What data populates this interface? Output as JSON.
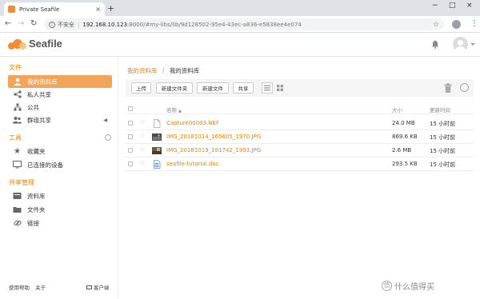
{
  "browser": {
    "tab_title": "Private Seafile",
    "tab_close": "×",
    "new_tab": "+",
    "win_min": "−",
    "win_max": "□",
    "win_close": "×",
    "back": "←",
    "forward": "→",
    "reload": "↻",
    "insecure_label": "不安全",
    "url_host": "192.168.10.123",
    "url_path": ":8000/#my-libs/lib/9d128502-95e4-43ec-a836-e5838ee4e074",
    "bookmark": "☆",
    "menu": "⋮"
  },
  "app": {
    "logo_text": "Seafile",
    "accent_color": "#eb8205"
  },
  "sidebar": {
    "section_files": "文件",
    "section_tools": "工具",
    "section_share_admin": "共享管理",
    "items_files": [
      {
        "label": "我的资料库",
        "icon": "user-icon",
        "active": true
      },
      {
        "label": "私人共享",
        "icon": "share-icon",
        "active": false
      },
      {
        "label": "公共",
        "icon": "org-icon",
        "active": false
      },
      {
        "label": "群组共享",
        "icon": "group-icon",
        "active": false,
        "right": "◀"
      }
    ],
    "items_tools": [
      {
        "label": "收藏夹",
        "icon": "star-icon"
      },
      {
        "label": "已连接的设备",
        "icon": "monitor-icon"
      }
    ],
    "items_share_admin": [
      {
        "label": "资料库",
        "icon": "library-icon"
      },
      {
        "label": "文件夹",
        "icon": "folder-icon"
      },
      {
        "label": "链接",
        "icon": "link-icon"
      }
    ],
    "footer_help": "使用帮助",
    "footer_about": "关于",
    "footer_client": "客户端"
  },
  "main": {
    "breadcrumb_link": "我的资料库",
    "breadcrumb_sep": "/",
    "breadcrumb_current": "我的资料库",
    "buttons": {
      "upload": "上传",
      "new_folder": "新建文件夹",
      "new_file": "新建文件",
      "share": "共享"
    },
    "columns": {
      "name": "名称",
      "sort_indicator": "▲",
      "size": "大小",
      "modified": "更新时间"
    },
    "files": [
      {
        "name": "Capture00003.NEF",
        "size": "24.0 MB",
        "modified": "15 小时前",
        "type": "doc"
      },
      {
        "name": "IMG_20181014_165605_1970.JPG",
        "size": "869.6 KB",
        "modified": "15 小时前",
        "type": "image"
      },
      {
        "name": "IMG_20181019_181742_1993.JPG",
        "size": "2.6 MB",
        "modified": "15 小时前",
        "type": "image"
      },
      {
        "name": "seafile-tutorial.doc",
        "size": "293.5 KB",
        "modified": "15 小时前",
        "type": "word"
      }
    ]
  },
  "watermark": "什么值得买"
}
